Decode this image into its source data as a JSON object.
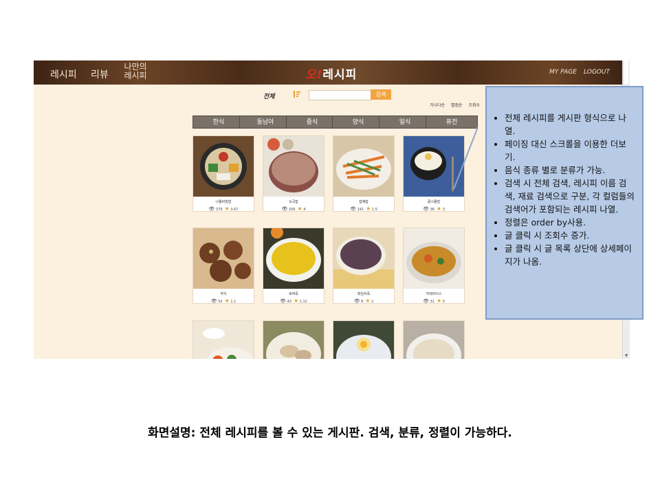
{
  "header": {
    "nav": {
      "recipe": "레시피",
      "review": "리뷰",
      "my_recipe": "나만의 레시피"
    },
    "logo_o": "오!",
    "logo_text": "레시피",
    "mypage": "MY PAGE",
    "logout": "LOGOUT"
  },
  "search": {
    "label": "전체",
    "button": "검색",
    "value": ""
  },
  "sort": [
    "가나다순",
    "별점순",
    "조회수"
  ],
  "tabs": [
    "한식",
    "동남아",
    "중식",
    "양식",
    "일식",
    "퓨전"
  ],
  "cards": [
    {
      "name": "나물비빔밥",
      "views": "379",
      "rating": "3.67"
    },
    {
      "name": "오곡밥",
      "views": "206",
      "rating": "4"
    },
    {
      "name": "잡채밥",
      "views": "141",
      "rating": "1.5"
    },
    {
      "name": "콩나물밥",
      "views": "36",
      "rating": "3"
    },
    {
      "name": "약식",
      "views": "52",
      "rating": "1.1"
    },
    {
      "name": "호박죽",
      "views": "43",
      "rating": "1.12"
    },
    {
      "name": "흑임자죽",
      "views": "8",
      "rating": "2"
    },
    {
      "name": "카레라이스",
      "views": "31",
      "rating": "0"
    }
  ],
  "callout": [
    "전체 레시피를 게시판 형식으로 나열.",
    "페이징 대신 스크롤을 이용한 더보기.",
    "음식 종류 별로 분류가 가능.",
    "검색 시 전체 검색, 레시피 이름 검색, 재료 검색으로 구분, 각 컬럼들의 검색어가 포함되는 레시피 나열.",
    "정렬은 order by사용.",
    "글 클릭 시 조회수 증가.",
    "글 클릭 시 글 목록 상단에 상세페이지가 나옴."
  ],
  "caption": "화면설명: 전체 레시피를 볼 수 있는 게시판. 검색, 분류, 정렬이 가능하다.",
  "colors": {
    "header_brown": "#5a3720",
    "page_bg": "#fcf0df",
    "tab_gray": "#7a7168",
    "search_orange": "#f0a642",
    "star": "#e59b2c",
    "callout_bg": "#b7cbe7"
  }
}
